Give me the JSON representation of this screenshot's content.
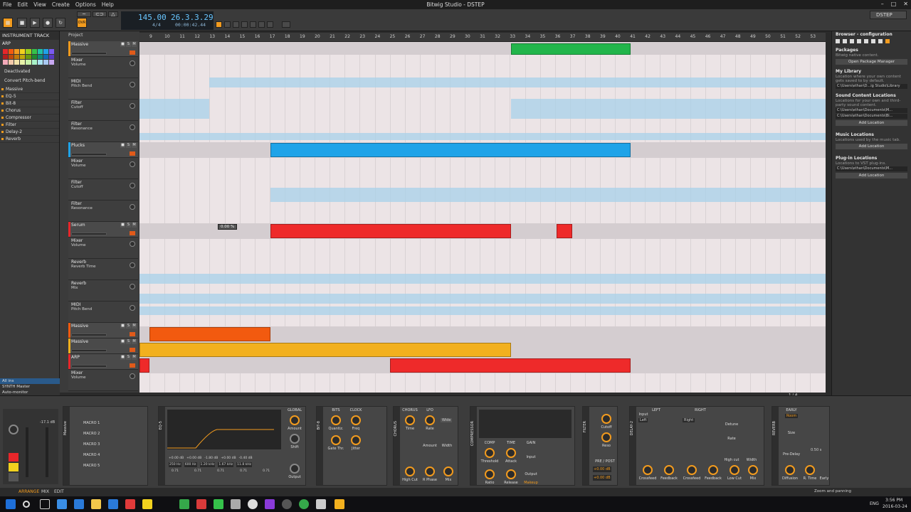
{
  "menu": [
    "File",
    "Edit",
    "View",
    "Create",
    "Options",
    "Help"
  ],
  "window_title": "Bitwig Studio - DSTEP",
  "window_controls": [
    "–",
    "□",
    "✕"
  ],
  "transport": {
    "tempo": "145.00",
    "position": "26.3.3.29",
    "time_sig": "4/4",
    "time": "00:00:42.44",
    "mode_label": "OVR"
  },
  "inspector": {
    "title": "INSTRUMENT TRACK",
    "track_name": "ARP",
    "state": "Deactivated",
    "convert": "Convert Pitch-bend",
    "devices": [
      "Massive",
      "EQ-5",
      "Bit-8",
      "Chorus",
      "Compressor",
      "Filter",
      "Delay-2",
      "Reverb"
    ]
  },
  "ruler": [
    "9",
    "10",
    "11",
    "12",
    "13",
    "14",
    "15",
    "16",
    "17",
    "18",
    "19",
    "20",
    "21",
    "22",
    "23",
    "24",
    "25",
    "26",
    "27",
    "28",
    "29",
    "30",
    "31",
    "32",
    "33",
    "34",
    "35",
    "36",
    "37",
    "38",
    "39",
    "40",
    "41",
    "42",
    "43",
    "44",
    "45",
    "46",
    "47",
    "48",
    "49",
    "50",
    "51",
    "52",
    "53"
  ],
  "project_label": "Project",
  "tracks": [
    {
      "name": "Massive",
      "kind": "inst",
      "color": "#f29b1e"
    },
    {
      "name": "Mixer",
      "sub": "Volume",
      "kind": "auto"
    },
    {
      "name": "MIDI",
      "sub": "Pitch Bend",
      "kind": "auto"
    },
    {
      "name": "Filter",
      "sub": "Cutoff",
      "kind": "auto"
    },
    {
      "name": "Filter",
      "sub": "Resonance",
      "kind": "auto"
    },
    {
      "name": "Plucks",
      "kind": "inst",
      "color": "#1fa3e8"
    },
    {
      "name": "Mixer",
      "sub": "Volume",
      "kind": "auto"
    },
    {
      "name": "Filter",
      "sub": "Cutoff",
      "kind": "auto"
    },
    {
      "name": "Filter",
      "sub": "Resonance",
      "kind": "auto"
    },
    {
      "name": "Serum",
      "kind": "inst",
      "color": "#e8262a"
    },
    {
      "name": "Mixer",
      "sub": "Volume",
      "kind": "auto"
    },
    {
      "name": "Reverb",
      "sub": "Reverb Time",
      "kind": "auto"
    },
    {
      "name": "Reverb",
      "sub": "Mix",
      "kind": "auto"
    },
    {
      "name": "MIDI",
      "sub": "Pitch Bend",
      "kind": "auto"
    },
    {
      "name": "Massive",
      "kind": "inst",
      "color": "#f25a0f"
    },
    {
      "name": "Massive",
      "kind": "inst",
      "color": "#f2b01e"
    },
    {
      "name": "ARP",
      "kind": "inst",
      "color": "#e8262a"
    },
    {
      "name": "Mixer",
      "sub": "Volume",
      "kind": "auto"
    }
  ],
  "tooltip": "0.00 %",
  "page_indicator": "1 / 4",
  "browser": {
    "title": "Browser - configuration",
    "packages_h": "Packages",
    "packages_t": "Bitwig native content.",
    "packages_btn": "Open Package Manager",
    "library_h": "My Library",
    "library_t": "Location where your own content gets saved to by default.",
    "library_path": "C:\\Users\\ethan\\D...ig Studio\\Library",
    "sound_h": "Sound Content Locations",
    "sound_t": "Locations for your own and third-party sound content.",
    "sound_paths": [
      "C:\\Users\\ethan\\Documents\\M...",
      "C:\\Users\\ethan\\Documents\\Bi..."
    ],
    "add": "Add Location",
    "music_h": "Music Locations",
    "music_t": "Locations used by the music tab.",
    "plugin_h": "Plug-in Locations",
    "plugin_t": "Locations to VST plug-ins.",
    "plugin_path": "C:\\Users\\ethan\\Documents\\M...",
    "dstep": "DSTEP"
  },
  "devices": {
    "master_label": "All ins",
    "synth_master": "SYNTH Master",
    "auto_monitor": "Auto-monitor",
    "meter_val": "-17.1 dB",
    "massive_macros": [
      "MACRO 1",
      "MACRO 2",
      "MACRO 3",
      "MACRO 4",
      "MACRO 5"
    ],
    "macro_value": "0",
    "eq_title": "EQ-5",
    "eq_global": "GLOBAL",
    "eq_amount": "Amount",
    "eq_shift": "Shift",
    "eq_output": "Output",
    "eq_vals": [
      "250 Hz",
      "600 Hz",
      "1.20 kHz",
      "1.67 kHz",
      "11.8 kHz"
    ],
    "eq_gains": [
      "+0.00 dB",
      "+0.00 dB",
      "-1.80 dB",
      "+0.00 dB",
      "-0.40 dB"
    ],
    "eq_q": [
      "0.71",
      "0.71",
      "0.71",
      "0.71",
      "0.71"
    ],
    "bit8_title": "BIT-8",
    "bit8": [
      "BITS",
      "CLOCK",
      "Quantiz.",
      "Freq",
      "Gate Thr.",
      "Jitter"
    ],
    "chorus_title": "CHORUS",
    "chorus": [
      "CHORUS",
      "LFO",
      "Time",
      "Rate",
      "Amount",
      "Width",
      "High Cut",
      "R Phase",
      "Mix"
    ],
    "wide_btn": "Wide",
    "comp_title": "COMPRESSOR",
    "comp": [
      "COMP",
      "TIME",
      "GAIN",
      "Threshold",
      "Attack",
      "Input",
      "Output",
      "Ratio",
      "Release",
      "Makeup"
    ],
    "filter_title": "FILTER",
    "filter": [
      "Cutoff",
      "Reso",
      "PRE / POST"
    ],
    "filter_vals": [
      "+0.00 dB",
      "+0.00 dB"
    ],
    "delay_title": "DELAY-2",
    "delay": [
      "LEFT",
      "RIGHT",
      "Input",
      "Left",
      "Right",
      "Detune",
      "Rate",
      "High cut",
      "Width",
      "Crossfeed",
      "Feedback",
      "Crossfeed",
      "Feedback",
      "Low Cut",
      "Mix"
    ],
    "reverb_title": "REVERB",
    "reverb": [
      "EARLY",
      "Room",
      "Size",
      "Pre-Delay",
      "Diffusion",
      "R. Time",
      "Early"
    ],
    "reverb_val": "0.50 s"
  },
  "statusbar": {
    "tabs": [
      "ARRANGE",
      "MIX",
      "EDIT"
    ],
    "right": "Zoom and panning"
  },
  "taskbar": {
    "time": "3:56 PM",
    "date": "2016-03-24",
    "lang": "ENG"
  }
}
